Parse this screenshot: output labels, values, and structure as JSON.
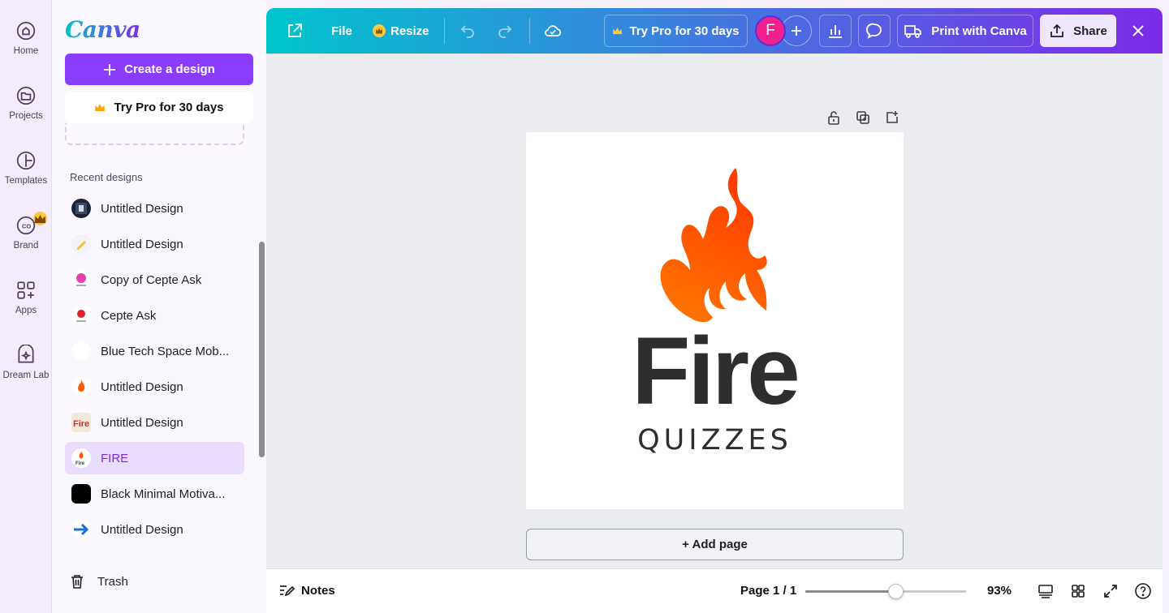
{
  "rail": {
    "items": [
      {
        "label": "Home",
        "icon": "home-icon"
      },
      {
        "label": "Projects",
        "icon": "folder-icon"
      },
      {
        "label": "Templates",
        "icon": "templates-icon"
      },
      {
        "label": "Brand",
        "icon": "brand-icon"
      },
      {
        "label": "Apps",
        "icon": "apps-icon"
      },
      {
        "label": "Dream Lab",
        "icon": "dream-lab-icon"
      }
    ]
  },
  "panel": {
    "logo": "Canva",
    "create_label": "Create a design",
    "try_pro_label": "Try Pro for 30 days",
    "recent_title": "Recent designs",
    "recent": [
      {
        "name": "Untitled Design",
        "active": false
      },
      {
        "name": "Untitled Design",
        "active": false
      },
      {
        "name": "Copy of Cepte Ask",
        "active": false
      },
      {
        "name": "Cepte Ask",
        "active": false
      },
      {
        "name": "Blue Tech Space Mob...",
        "active": false
      },
      {
        "name": "Untitled Design",
        "active": false
      },
      {
        "name": "Untitled Design",
        "active": false
      },
      {
        "name": "FIRE",
        "active": true
      },
      {
        "name": "Black Minimal Motiva...",
        "active": false
      },
      {
        "name": "Untitled Design",
        "active": false
      }
    ],
    "trash_label": "Trash"
  },
  "topbar": {
    "file_label": "File",
    "resize_label": "Resize",
    "try_pro_label": "Try Pro for 30 days",
    "avatar_initial": "F",
    "print_label": "Print with Canva",
    "share_label": "Share"
  },
  "design": {
    "headline": "Fire",
    "subline": "QUIZZES",
    "flame_colors": [
      "#ff7a00",
      "#ff3d00"
    ]
  },
  "canvas": {
    "add_page_label": "+ Add page"
  },
  "footer": {
    "notes_label": "Notes",
    "page_indicator": "Page 1 / 1",
    "zoom_percent": "93%",
    "zoom_slider_fraction": 0.56
  },
  "colors": {
    "accent": "#8b3dff",
    "active_bg": "#eadcfd",
    "avatar": "#f0208e",
    "crown": "#ffc83d"
  }
}
